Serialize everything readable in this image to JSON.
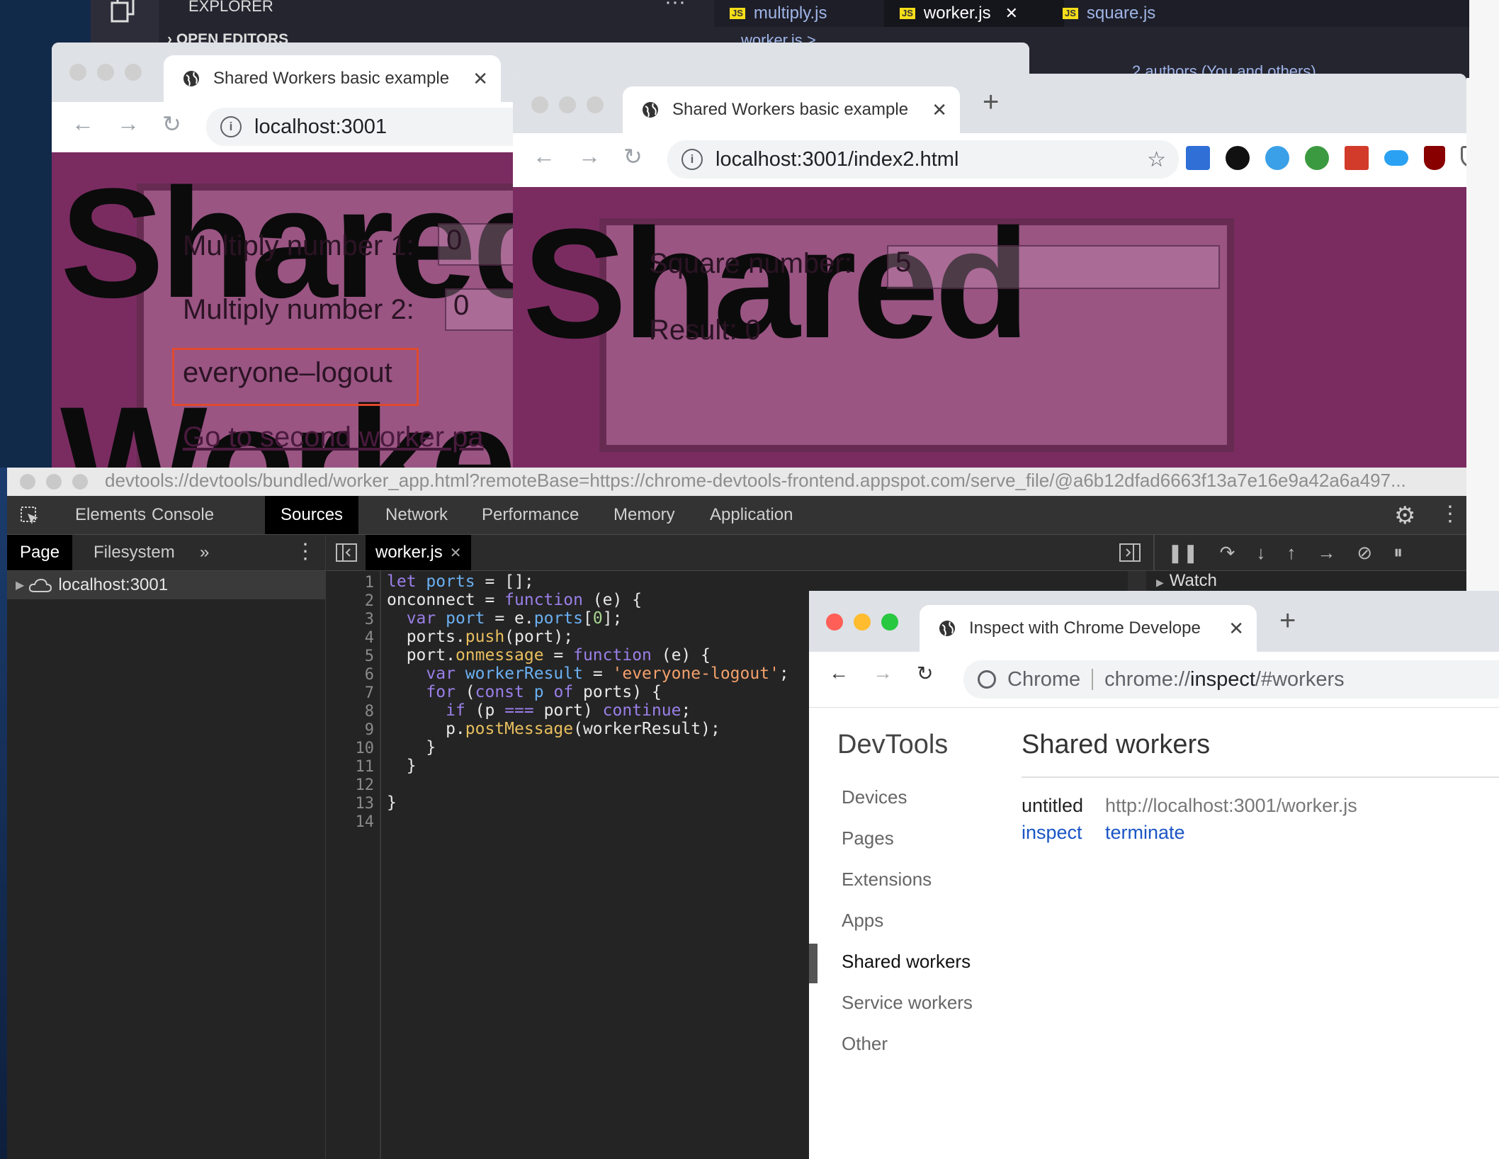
{
  "vscode": {
    "explorer_title": "EXPLORER",
    "more": "···",
    "open_editors": "OPEN EDITORS",
    "tabs": [
      {
        "badge": "JS",
        "label": "multiply.js"
      },
      {
        "badge": "JS",
        "label": "worker.js",
        "close": "✕"
      },
      {
        "badge": "JS",
        "label": "square.js"
      }
    ],
    "breadcrumb": "worker.js >",
    "blame": "2 authors (You and others)"
  },
  "browser1": {
    "tab_title": "Shared Workers basic example",
    "tab_close": "✕",
    "url": "localhost:3001",
    "big_text_1": "Shared",
    "big_text_2": "Worker",
    "label_multiply1": "Multiply number 1:",
    "value_multiply1": "0",
    "label_multiply2": "Multiply number 2:",
    "value_multiply2": "0",
    "result_text": "everyone–logout",
    "link_text": "Go to second worker pa"
  },
  "browser2": {
    "tab_title": "Shared Workers basic example",
    "tab_close": "✕",
    "new_tab": "+",
    "url": "localhost:3001/index2.html",
    "big_text": "Shared",
    "label_square": "Square number:",
    "value_square": "5",
    "result_label": "Result: 0"
  },
  "devtools": {
    "url": "devtools://devtools/bundled/worker_app.html?remoteBase=https://chrome-devtools-frontend.appspot.com/serve_file/@a6b12dfad6663f13a7e16e9a42a6a497...",
    "tabs": [
      "Elements",
      "Console",
      "Sources",
      "Network",
      "Performance",
      "Memory",
      "Application"
    ],
    "active_tab": "Sources",
    "nav_tabs": {
      "page": "Page",
      "filesystem": "Filesystem",
      "more": "»"
    },
    "tree_item": "localhost:3001",
    "file_tab": "worker.js",
    "file_tab_close": "✕",
    "watch": "Watch",
    "line_numbers": [
      "1",
      "2",
      "3",
      "4",
      "5",
      "6",
      "7",
      "8",
      "9",
      "10",
      "11",
      "12",
      "13",
      "14"
    ]
  },
  "inspect": {
    "tab_title": "Inspect with Chrome Develope",
    "tab_close": "✕",
    "new_tab": "+",
    "chip": "Chrome",
    "url_prefix": "chrome://",
    "url_host": "inspect",
    "url_suffix": "/#workers",
    "sidebar_title": "DevTools",
    "menu": [
      "Devices",
      "Pages",
      "Extensions",
      "Apps",
      "Shared workers",
      "Service workers",
      "Other"
    ],
    "active_menu": "Shared workers",
    "section_title": "Shared workers",
    "worker_name": "untitled",
    "worker_url": "http://localhost:3001/worker.js",
    "action_inspect": "inspect",
    "action_terminate": "terminate"
  },
  "colors": {
    "page_bg": "#7a2c61",
    "devtools_bg": "#242424",
    "link": "#1a55c4",
    "highlight_border": "#e04a2f"
  }
}
